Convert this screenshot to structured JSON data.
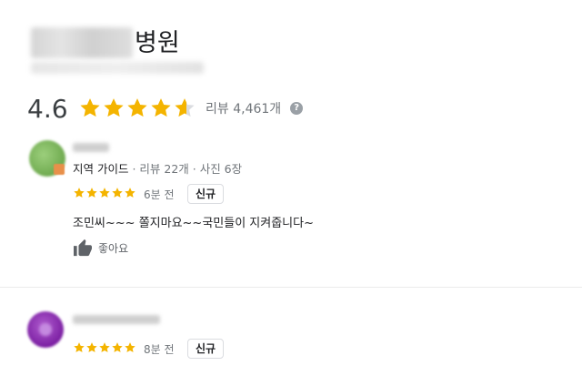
{
  "place": {
    "title_visible_suffix": "병원"
  },
  "rating": {
    "value": "4.6",
    "stars_fill": 0.92,
    "review_count_label": "리뷰 4,461개",
    "help_symbol": "?"
  },
  "reviews": [
    {
      "reviewer_meta_role": "지역 가이드",
      "reviewer_meta_stats": " · 리뷰 22개 · 사진 6장",
      "stars": 5,
      "time": "6분 전",
      "badge": "신규",
      "text": "조민씨~~~ 쫄지마요~~국민들이 지켜줍니다~",
      "like_label": "좋아요"
    },
    {
      "stars": 5,
      "time": "8분 전",
      "badge": "신규"
    }
  ],
  "colors": {
    "star": "#f4b400",
    "star_empty": "#dadce0",
    "muted_text": "#70757a"
  },
  "icons": [
    "help-icon",
    "thumbs-up-icon",
    "star-icon"
  ]
}
